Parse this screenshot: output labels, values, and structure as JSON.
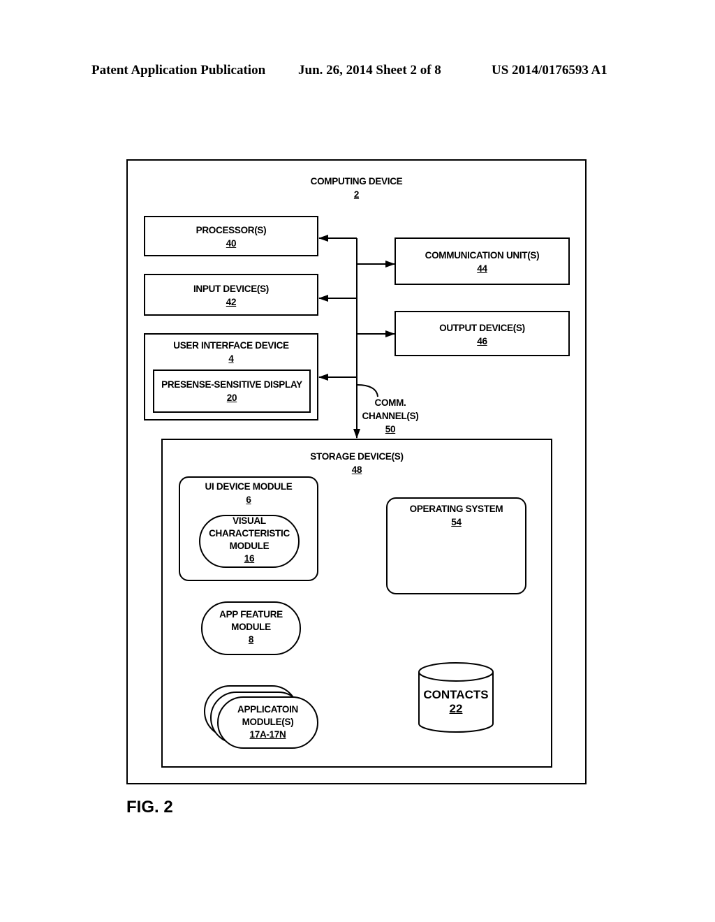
{
  "header": {
    "publication": "Patent Application Publication",
    "date_sheet": "Jun. 26, 2014  Sheet 2 of 8",
    "patent_number": "US 2014/0176593 A1"
  },
  "diagram": {
    "computing_device": {
      "label": "COMPUTING DEVICE",
      "ref": "2"
    },
    "processors": {
      "label": "PROCESSOR(S)",
      "ref": "40"
    },
    "input_devices": {
      "label": "INPUT DEVICE(S)",
      "ref": "42"
    },
    "user_interface_device": {
      "label": "USER INTERFACE DEVICE",
      "ref": "4"
    },
    "presence_sensitive_display": {
      "label": "PRESENSE-SENSITIVE DISPLAY",
      "ref": "20"
    },
    "communication_units": {
      "label": "COMMUNICATION UNIT(S)",
      "ref": "44"
    },
    "output_devices": {
      "label": "OUTPUT DEVICE(S)",
      "ref": "46"
    },
    "comm_channels": {
      "line1": "COMM.",
      "line2": "CHANNEL(S)",
      "ref": "50"
    },
    "storage_devices": {
      "label": "STORAGE DEVICE(S)",
      "ref": "48"
    },
    "ui_device_module": {
      "label": "UI DEVICE MODULE",
      "ref": "6"
    },
    "visual_characteristic_module": {
      "line1": "VISUAL",
      "line2": "CHARACTERISTIC",
      "line3": "MODULE",
      "ref": "16"
    },
    "operating_system": {
      "label": "OPERATING SYSTEM",
      "ref": "54"
    },
    "app_feature_module": {
      "line1": "APP FEATURE",
      "line2": "MODULE",
      "ref": "8"
    },
    "application_modules": {
      "line1": "APPLICATOIN",
      "line2": "MODULE(S)",
      "ref": "17A-17N"
    },
    "contacts": {
      "label": "CONTACTS",
      "ref": "22"
    }
  },
  "figure_label": "FIG. 2"
}
